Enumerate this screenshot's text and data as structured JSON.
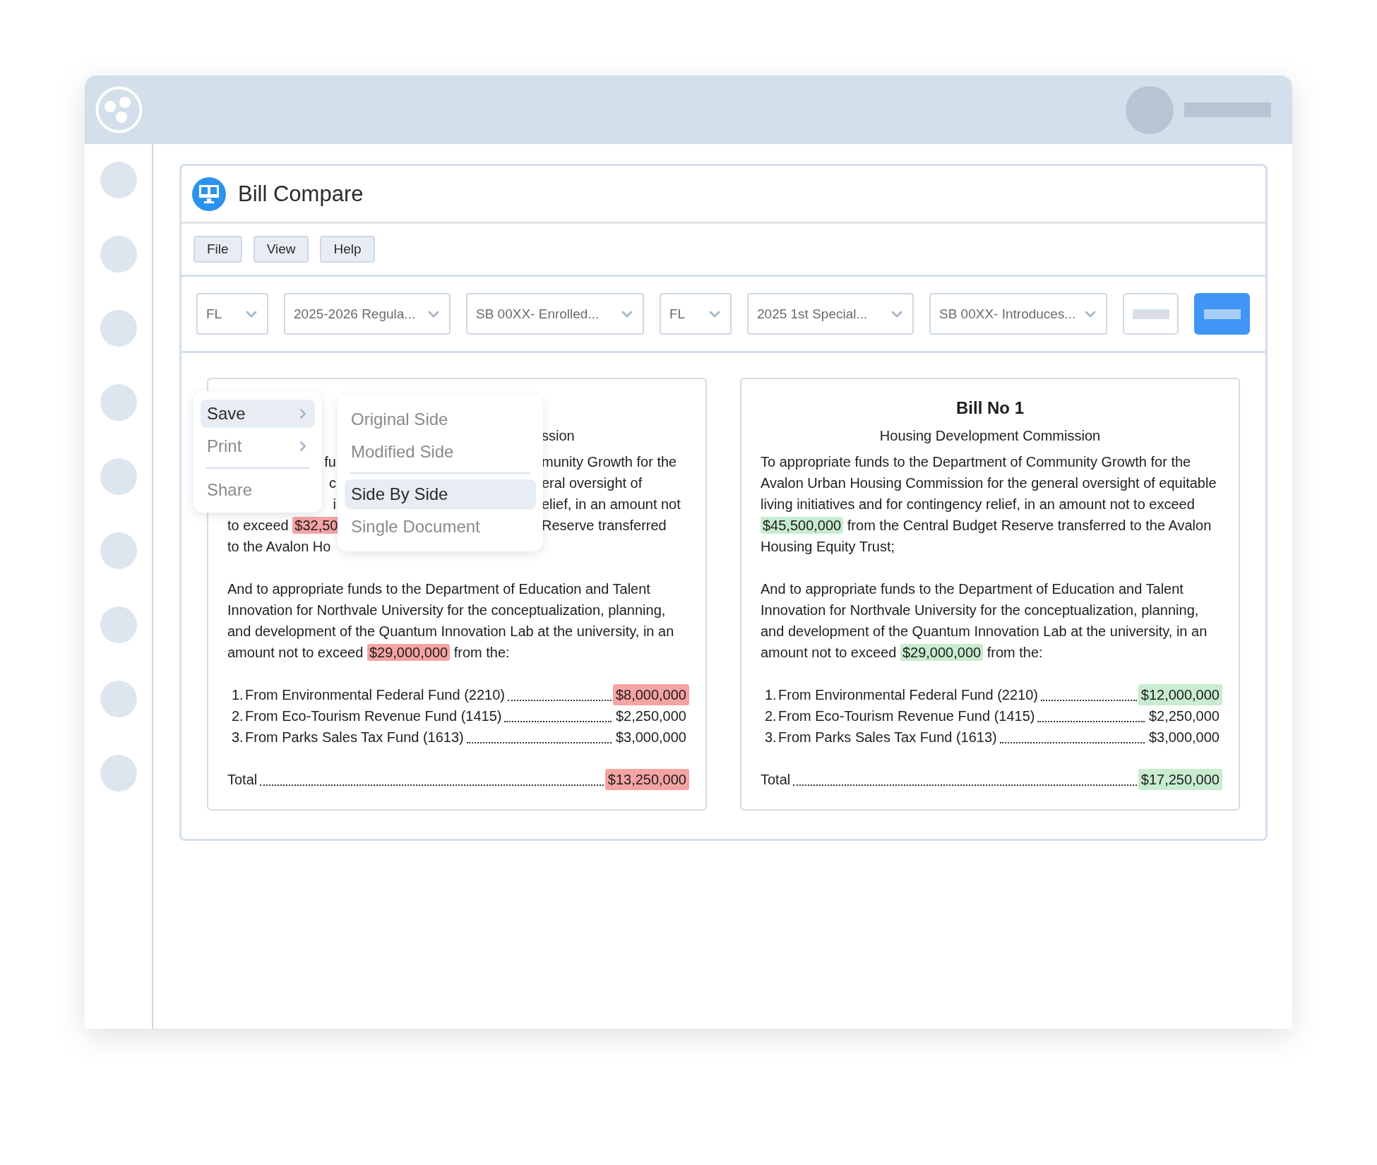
{
  "panel": {
    "title": "Bill Compare"
  },
  "menu_bar": [
    {
      "label": "File"
    },
    {
      "label": "View"
    },
    {
      "label": "Help"
    }
  ],
  "selectors": [
    {
      "value": "FL",
      "kind": "state"
    },
    {
      "value": "2025-2026 Regula...",
      "kind": "session"
    },
    {
      "value": "SB 00XX- Enrolled...",
      "kind": "bill"
    },
    {
      "value": "FL",
      "kind": "state"
    },
    {
      "value": "2025 1st Special...",
      "kind": "session"
    },
    {
      "value": "SB 00XX- Introduces...",
      "kind": "bill"
    }
  ],
  "action_buttons": [
    {
      "kind": "secondary"
    },
    {
      "kind": "primary"
    }
  ],
  "context_menu": {
    "items": [
      {
        "kind": "item",
        "label": "Save",
        "selected": true,
        "has_submenu": true
      },
      {
        "kind": "item",
        "label": "Print",
        "selected": false,
        "has_submenu": true
      },
      {
        "kind": "separator"
      },
      {
        "kind": "item",
        "label": "Share",
        "selected": false,
        "has_submenu": false
      }
    ]
  },
  "submenu": {
    "items": [
      {
        "kind": "item",
        "label": "Original Side",
        "selected": false
      },
      {
        "kind": "item",
        "label": "Modified Side",
        "selected": false
      },
      {
        "kind": "separator"
      },
      {
        "kind": "item",
        "label": "Side By Side",
        "selected": true
      },
      {
        "kind": "item",
        "label": "Single Document",
        "selected": false
      }
    ]
  },
  "documents": [
    {
      "kind": "removed",
      "fragment_lines": [
        {
          "end": "ssion"
        },
        {
          "peek": "fu",
          "end": "munity Growth for the"
        },
        {
          "peek": "c",
          "end": "eral oversight of"
        },
        {
          "peek": "i",
          "end": "elief, in an amount not"
        },
        {
          "start": [
            {
              "text": "to exceed ",
              "highlight": false
            },
            {
              "text": "$32,50",
              "highlight": true
            }
          ],
          "end": "Reserve transferred"
        },
        {
          "start": [
            {
              "text": "to the Avalon Ho",
              "highlight": false
            }
          ]
        }
      ],
      "paragraph_2": [
        {
          "text": "And to appropriate funds to the Department of Education and Talent Innovation for Northvale University for the conceptualization, planning, and development of the Quantum Innovation Lab at the university, in an amount not to exceed ",
          "highlight": false
        },
        {
          "text": "$29,000,000",
          "highlight": true
        },
        {
          "text": " from the:",
          "highlight": false
        }
      ],
      "funds": [
        {
          "number": "1.",
          "label": "From Environmental Federal Fund (2210)",
          "amount": "$8,000,000",
          "highlight": true
        },
        {
          "number": "2.",
          "label": "From Eco-Tourism Revenue Fund (1415)",
          "amount": "$2,250,000",
          "highlight": false
        },
        {
          "number": "3.",
          "label": "From Parks Sales Tax Fund (1613)",
          "amount": "$3,000,000",
          "highlight": false
        }
      ],
      "total": {
        "label": "Total",
        "amount": "$13,250,000",
        "highlight": true
      }
    },
    {
      "kind": "added",
      "title": "Bill No 1",
      "subtitle": "Housing Development Commission",
      "paragraph_1": [
        {
          "text": "To appropriate funds to the Department of Community Growth for the Avalon Urban Housing Commission for the general oversight of equitable living initiatives and for contingency relief, in an amount not to exceed ",
          "highlight": false
        },
        {
          "text": "$45,500,000",
          "highlight": true
        },
        {
          "text": " from the Central Budget Reserve transferred to the Avalon Housing Equity Trust;",
          "highlight": false
        }
      ],
      "paragraph_2": [
        {
          "text": "And to appropriate funds to the Department of Education and Talent Innovation for Northvale University for the conceptualization, planning, and development of the Quantum Innovation Lab at the university, in an amount not to exceed ",
          "highlight": false
        },
        {
          "text": "$29,000,000",
          "highlight": true
        },
        {
          "text": " from the:",
          "highlight": false
        }
      ],
      "funds": [
        {
          "number": "1.",
          "label": "From Environmental Federal Fund (2210)",
          "amount": "$12,000,000",
          "highlight": true
        },
        {
          "number": "2.",
          "label": "From Eco-Tourism Revenue Fund (1415)",
          "amount": "$2,250,000",
          "highlight": false
        },
        {
          "number": "3.",
          "label": "From Parks Sales Tax Fund (1613)",
          "amount": "$3,000,000",
          "highlight": false
        }
      ],
      "total": {
        "label": "Total",
        "amount": "$17,250,000",
        "highlight": true
      }
    }
  ]
}
